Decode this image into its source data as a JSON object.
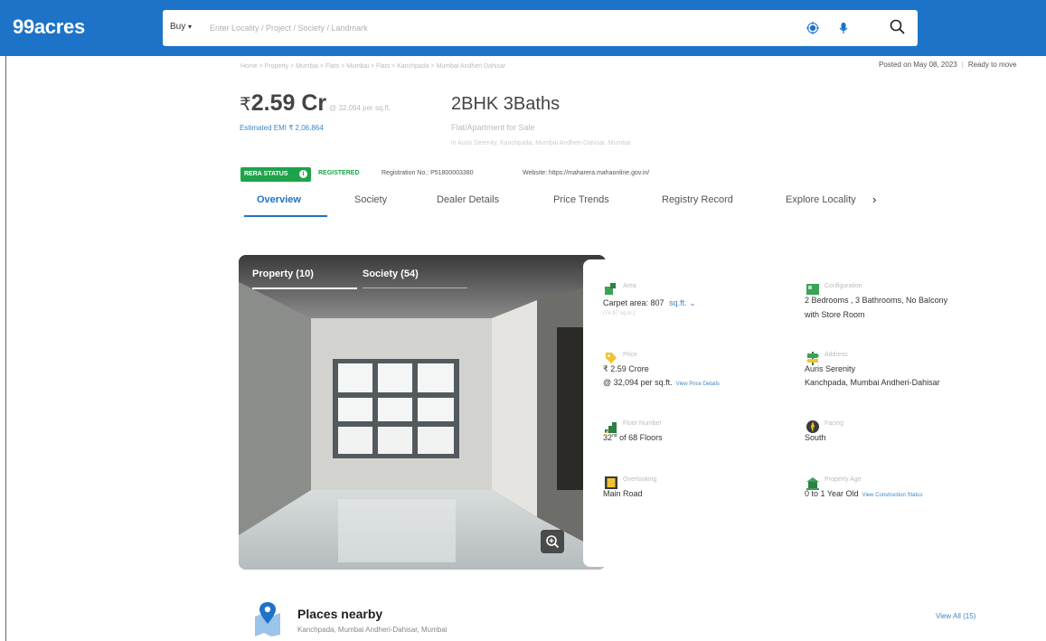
{
  "header": {
    "logo": "99acres",
    "buy_label": "Buy",
    "search_placeholder": "Enter Locality / Project / Society / Landmark",
    "colors": {
      "brand": "#1c73c8"
    }
  },
  "breadcrumb": "Home > Property > Mumbai > Flats > Mumbai > Flats > Kanchpada > Mumbai Andheri Dahisar",
  "posted": {
    "date": "Posted on May 08, 2023",
    "status": "Ready to move"
  },
  "price": {
    "rupee": "₹",
    "amount": "2.59 Cr",
    "per_sqft": "@ 32,094 per sq.ft.",
    "emi": "Estimated EMI ₹ 2,06,864"
  },
  "listing": {
    "config_title": "2BHK 3Baths",
    "type": "Flat/Apartment for Sale",
    "address": "in Auris Serenity, Kanchpada, Mumbai Andheri-Dahisar, Mumbai"
  },
  "rera": {
    "badge": "RERA STATUS",
    "registered": "REGISTERED",
    "reg_no": "Registration No.: P51800003380",
    "website": "Website: https://maharera.mahaonline.gov.in/"
  },
  "tabs": [
    {
      "label": "Overview"
    },
    {
      "label": "Society"
    },
    {
      "label": "Dealer Details"
    },
    {
      "label": "Price Trends"
    },
    {
      "label": "Registry Record"
    },
    {
      "label": "Explore Locality"
    }
  ],
  "gallery": {
    "tabs": [
      {
        "label": "Property (10)"
      },
      {
        "label": "Society (54)"
      }
    ]
  },
  "details": {
    "area": {
      "label": "Area",
      "line1": "Carpet area: 807",
      "unit": "sq.ft.",
      "sub": "(74.97 sq.m.)"
    },
    "configuration": {
      "label": "Configuration",
      "line1": "2 Bedrooms , 3 Bathrooms, No Balcony",
      "line2": "with Store Room"
    },
    "price": {
      "label": "Price",
      "line1": "₹ 2.59 Crore",
      "line2": "@ 32,094 per sq.ft.",
      "link": "View Price Details"
    },
    "address": {
      "label": "Address",
      "line1": "Auris Serenity",
      "line2": "Kanchpada, Mumbai Andheri-Dahisar"
    },
    "floor": {
      "label": "Floor Number",
      "floor_num": "32",
      "floor_sup": "nd",
      "floor_total": "of 68 Floors"
    },
    "facing": {
      "label": "Facing",
      "line1": "South"
    },
    "overlooking": {
      "label": "Overlooking",
      "line1": "Main Road"
    },
    "age": {
      "label": "Property Age",
      "line1": "0 to 1 Year Old",
      "link": "View Construction Status"
    }
  },
  "places": {
    "title": "Places nearby",
    "subtitle": "Kanchpada, Mumbai Andheri-Dahisar, Mumbai",
    "view_all": "View All (15)"
  }
}
